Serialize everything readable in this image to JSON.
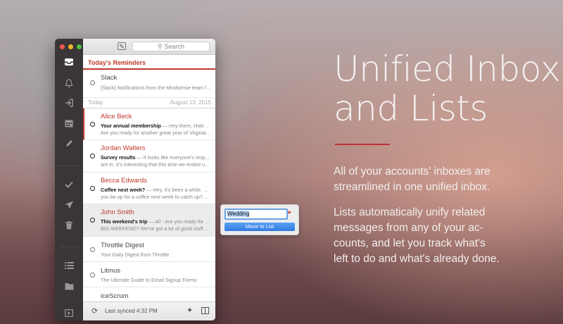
{
  "search": {
    "placeholder": "Search"
  },
  "reminders": {
    "title": "Today's Reminders",
    "items": [
      {
        "sender": "Slack",
        "preview": "[Slack] Notifications from the Mindsense team for A..."
      }
    ]
  },
  "date_header": {
    "left": "Today",
    "right": "August 13, 2015"
  },
  "messages": [
    {
      "sender": "Alice Beck",
      "subject": "Your annual membership",
      "sep": " — ",
      "preview1": "Hey there, Hokies fan!",
      "preview2": "Are you ready for another great year of Virginia Tech..."
    },
    {
      "sender": "Jordan Walters",
      "subject": "Survey results",
      "sep": " — ",
      "preview1": "It looks like everyone's responses",
      "preview2": "are in. It's interesting that this time we ended up all..."
    },
    {
      "sender": "Becca Edwards",
      "subject": "Coffee next week?",
      "sep": " — ",
      "preview1": "Hey, It's been a while. Would",
      "preview2": "you be up for a coffee next week to catch up? Lunch..."
    },
    {
      "sender": "John Smith",
      "subject": "This weekend's trip",
      "sep": " — ",
      "preview1": "All - Are you ready for THE",
      "preview2": "BIG WEEKEND? We've got a lot of good stuff sche..."
    },
    {
      "sender": "Throttle Digest",
      "preview2": "Your Daily Digest from Throttle"
    },
    {
      "sender": "Litmus",
      "preview2": "The Ultimate Guide to Email Signup Forms"
    },
    {
      "sender": "iceScrum"
    }
  ],
  "status": {
    "last_synced": "Last synced 4:32 PM"
  },
  "popover": {
    "value": "Wedding",
    "button": "Move to List"
  },
  "marketing": {
    "title_line1": "Unified Inbox",
    "title_line2": "and Lists",
    "para1_line1": "All of your accounts' inboxes are",
    "para1_line2": "streamlined in one unified inbox.",
    "para2_line1": "Lists automatically unify related",
    "para2_line2": "messages from any of your ac-",
    "para2_line3": "counts, and let you track what's",
    "para2_line4": "left to do and what's already done."
  },
  "colors": {
    "accent": "#c0392b",
    "sidebar": "#3a3536",
    "button": "#2f7ae0"
  },
  "icons": [
    "compose-icon",
    "search-icon",
    "inbox-icon",
    "bell-icon",
    "signin-icon",
    "calendar-icon",
    "pencil-icon",
    "check-icon",
    "send-icon",
    "trash-icon",
    "list-icon",
    "folder-icon",
    "play-icon",
    "sync-icon",
    "wand-icon",
    "split-view-icon"
  ]
}
